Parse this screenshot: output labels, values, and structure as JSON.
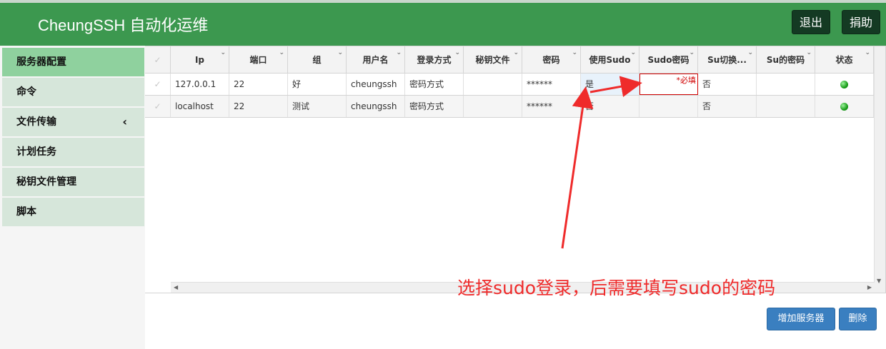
{
  "header": {
    "title": "CheungSSH 自动化运维",
    "logout_label": "退出",
    "donate_label": "捐助"
  },
  "sidebar": {
    "items": [
      {
        "label": "服务器配置",
        "active": true
      },
      {
        "label": "命令"
      },
      {
        "label": "文件传输",
        "has_chevron": true
      },
      {
        "label": "计划任务"
      },
      {
        "label": "秘钥文件管理"
      },
      {
        "label": "脚本"
      }
    ],
    "chevron_glyph": "‹"
  },
  "table": {
    "columns": [
      "Ip",
      "端口",
      "组",
      "用户名",
      "登录方式",
      "秘钥文件",
      "密码",
      "使用Sudo",
      "Sudo密码",
      "Su切换...",
      "Su的密码",
      "状态"
    ],
    "rows": [
      {
        "ip": "127.0.0.1",
        "port": "22",
        "group": "好",
        "user": "cheungssh",
        "login": "密码方式",
        "key": "",
        "password": "******",
        "sudo": "是",
        "sudo_pwd": "*必填",
        "su": "否",
        "su_pwd": "",
        "status": "online"
      },
      {
        "ip": "localhost",
        "port": "22",
        "group": "测试",
        "user": "cheungssh",
        "login": "密码方式",
        "key": "",
        "password": "******",
        "sudo": "否",
        "sudo_pwd": "",
        "su": "否",
        "su_pwd": "",
        "status": "online"
      }
    ],
    "status_color": "#1a9e1a"
  },
  "annotation": {
    "text": "选择sudo登录，后需要填写sudo的密码",
    "color": "#ef2b2b"
  },
  "actions": {
    "add_label": "增加服务器",
    "delete_label": "删除"
  },
  "colors": {
    "header_bg": "#3c984f",
    "sidebar_active": "#8fd19e",
    "sidebar_item": "#d6e6da",
    "button_primary": "#3a7fc0"
  }
}
